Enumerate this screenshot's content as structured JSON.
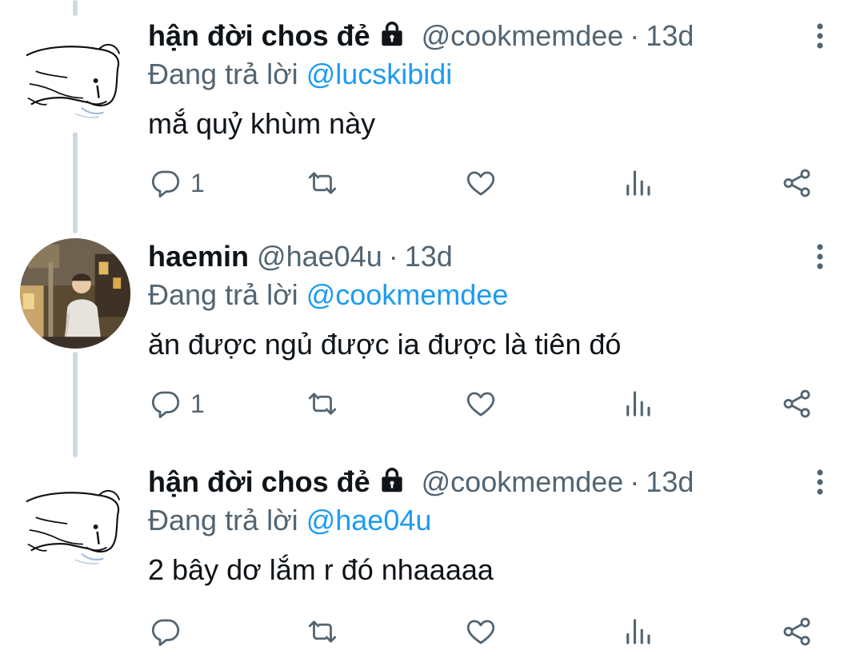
{
  "tweets": [
    {
      "display_name": "hận đời chos đẻ",
      "handle": "@cookmemdee",
      "separator": "·",
      "time": "13d",
      "reply_label": "Đang trả lời",
      "reply_to": "@lucskibidi",
      "text": "mắ quỷ khùm này",
      "reply_count": "1",
      "avatar": "sketch-avatar",
      "locked": true
    },
    {
      "display_name": "haemin",
      "handle": "@hae04u",
      "separator": "·",
      "time": "13d",
      "reply_label": "Đang trả lời",
      "reply_to": "@cookmemdee",
      "text": "ăn được ngủ được ia được là tiên đó",
      "reply_count": "1",
      "avatar": "photo-avatar",
      "locked": false
    },
    {
      "display_name": "hận đời chos đẻ",
      "handle": "@cookmemdee",
      "separator": "·",
      "time": "13d",
      "reply_label": "Đang trả lời",
      "reply_to": "@hae04u",
      "text": "2 bây dơ lắm r đó nhaaaaa",
      "reply_count": "",
      "avatar": "sketch-avatar",
      "locked": true
    }
  ],
  "icons": [
    "reply-icon",
    "retweet-icon",
    "like-icon",
    "views-icon",
    "share-icon",
    "more-icon",
    "lock-icon"
  ],
  "colors": {
    "text": "#0f1419",
    "secondary": "#536471",
    "mention": "#1d9bf0",
    "thread_line": "#cfd9de"
  }
}
